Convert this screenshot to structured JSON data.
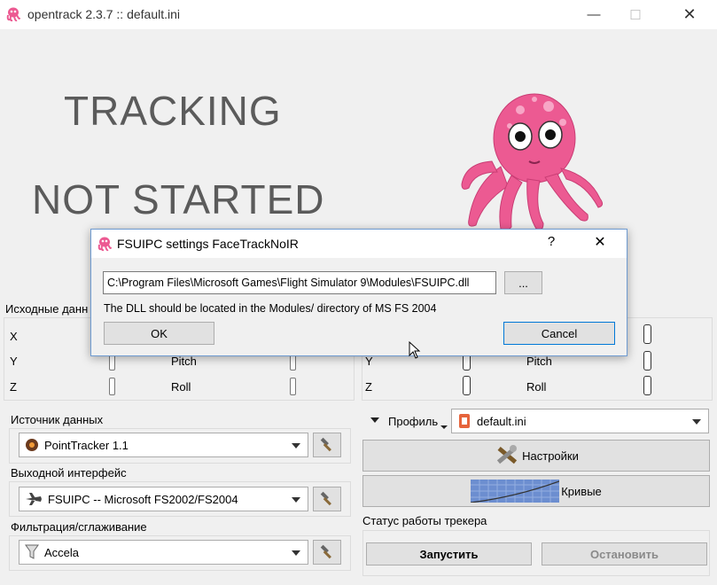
{
  "window": {
    "title": "opentrack 2.3.7 :: default.ini",
    "minimize": "—",
    "maximize": "☐",
    "close": "✕"
  },
  "status": {
    "line1": "TRACKING",
    "line2": "NOT STARTED"
  },
  "raw": {
    "label": "Исходные данн",
    "rows": [
      "X",
      "Y",
      "Z"
    ],
    "rotations": [
      "Pitch",
      "Roll"
    ]
  },
  "game": {
    "rows": [
      "Y",
      "Z"
    ],
    "rotations": [
      "Pitch",
      "Roll"
    ]
  },
  "source": {
    "label": "Источник данных",
    "value": "PointTracker 1.1"
  },
  "output": {
    "label": "Выходной интерфейс",
    "value": "FSUIPC -- Microsoft FS2002/FS2004"
  },
  "filter": {
    "label": "Фильтрация/сглаживание",
    "value": "Accela"
  },
  "profile": {
    "label": "Профиль",
    "value": "default.ini"
  },
  "buttons": {
    "settings": "Настройки",
    "curves": "Кривые",
    "start": "Запустить",
    "stop": "Остановить"
  },
  "tracker_status": {
    "label": "Статус работы трекера"
  },
  "dialog": {
    "title": "FSUIPC settings FaceTrackNoIR",
    "help": "?",
    "close": "✕",
    "dll_path": "C:\\Program Files\\Microsoft Games\\Flight Simulator 9\\Modules\\FSUIPC.dll",
    "browse": "...",
    "note": "The DLL should be located in the Modules/ directory of MS FS 2004",
    "ok": "OK",
    "cancel": "Cancel"
  },
  "icons": {
    "app": "octopus-icon",
    "source": "pointtracker-icon",
    "output": "airplane-icon",
    "filter": "funnel-icon",
    "profile": "profile-file-icon",
    "settings": "tools-icon",
    "curves": "curve-graph-icon",
    "tool_button": "hammer-icon"
  },
  "colors": {
    "accent": "#0078d7",
    "mascot": "#ec5a92"
  }
}
